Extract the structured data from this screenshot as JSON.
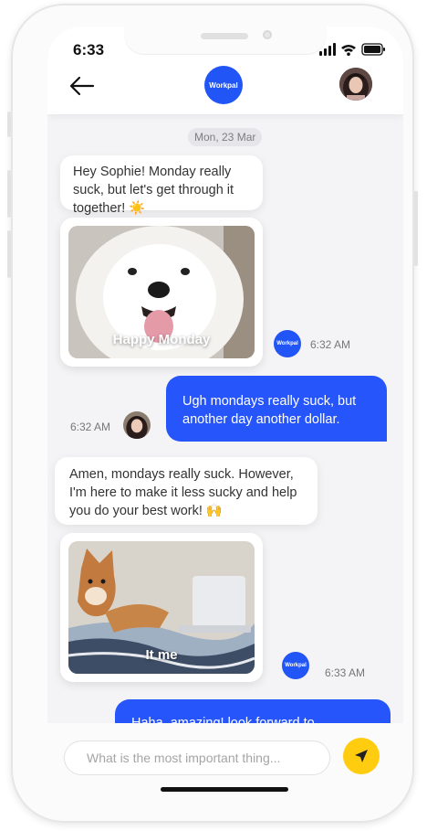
{
  "status_bar": {
    "time": "6:33"
  },
  "header": {
    "brand": "Workpal"
  },
  "thread": {
    "date": "Mon, 23 Mar",
    "messages": [
      {
        "from": "bot",
        "text": "Hey Sophie! Monday really suck, but let's get through it together! ☀️"
      },
      {
        "from": "bot",
        "type": "image",
        "caption": "Happy Monday",
        "time": "6:32 AM"
      },
      {
        "from": "user",
        "text": "Ugh mondays really suck, but another day another dollar.",
        "time": "6:32 AM"
      },
      {
        "from": "bot",
        "text": "Amen, mondays really suck. However, I'm here to make it less sucky and help you do your best work! 🙌"
      },
      {
        "from": "bot",
        "type": "image",
        "caption": "It me",
        "time": "6:33 AM"
      },
      {
        "from": "user",
        "text": "Haha, amazing! look forward to"
      }
    ],
    "bot_avatar_label": "Workpal"
  },
  "composer": {
    "placeholder": "What is the most important thing..."
  },
  "colors": {
    "accent": "#2655fb",
    "send": "#ffcc10"
  },
  "icons": {
    "back": "arrow-left-icon",
    "send": "send-plane-icon"
  }
}
